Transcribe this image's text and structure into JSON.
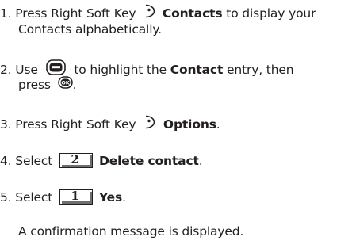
{
  "steps": [
    {
      "number": "1.",
      "pre": "Press Right Soft Key",
      "icon": "right-soft-key-icon",
      "bold": "Contacts",
      "post": "to display your",
      "cont": "Contacts alphabetically."
    },
    {
      "number": "2.",
      "pre": "Use",
      "icon": "navigation-key-icon",
      "mid": "to highlight the",
      "bold": "Contact",
      "post": "entry, then",
      "cont_pre": "press",
      "cont_icon": "ok-key-icon",
      "ok_label": "OK",
      "cont_post": "."
    },
    {
      "number": "3.",
      "pre": "Press Right Soft Key",
      "icon": "right-soft-key-icon",
      "bold": "Options",
      "post": "."
    },
    {
      "number": "4.",
      "pre": "Select",
      "key": "2",
      "bold": "Delete contact",
      "post": "."
    },
    {
      "number": "5.",
      "pre": "Select",
      "key": "1",
      "bold": "Yes",
      "post": "."
    }
  ],
  "note": "A confirmation message is displayed."
}
